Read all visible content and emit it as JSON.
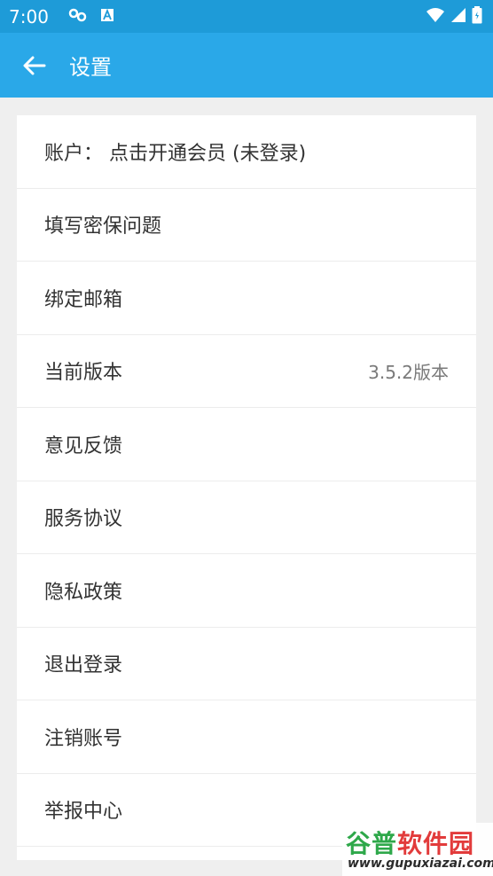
{
  "status_bar": {
    "time": "7:00"
  },
  "app_bar": {
    "title": "设置"
  },
  "settings": {
    "items": [
      {
        "label": "账户： 点击开通会员 (未登录)",
        "value": ""
      },
      {
        "label": "填写密保问题",
        "value": ""
      },
      {
        "label": "绑定邮箱",
        "value": ""
      },
      {
        "label": "当前版本",
        "value": "3.5.2版本"
      },
      {
        "label": "意见反馈",
        "value": ""
      },
      {
        "label": "服务协议",
        "value": ""
      },
      {
        "label": "隐私政策",
        "value": ""
      },
      {
        "label": "退出登录",
        "value": ""
      },
      {
        "label": "注销账号",
        "value": ""
      },
      {
        "label": "举报中心",
        "value": ""
      }
    ]
  },
  "watermark": {
    "brand_a": "谷普",
    "brand_b": "软件园",
    "url": "www.gupuxiazai.com"
  }
}
